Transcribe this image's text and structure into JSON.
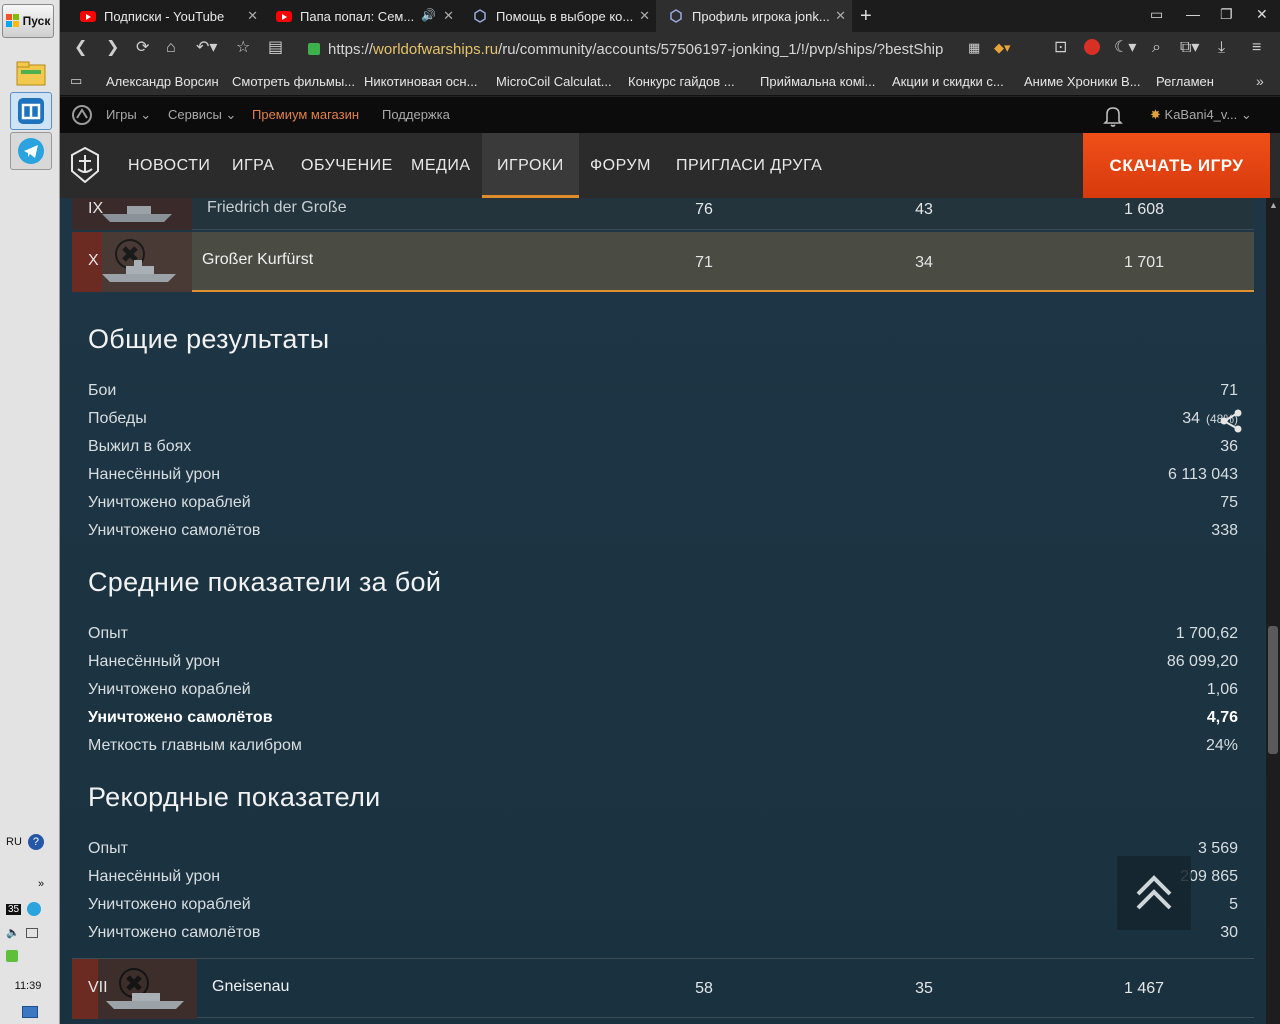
{
  "taskbar": {
    "start_label": "Пуск",
    "tray": {
      "lang": "RU",
      "badge": "35",
      "time": "11:39"
    }
  },
  "browser": {
    "tabs": [
      {
        "title": "Подписки - YouTube",
        "favicon": "youtube-icon"
      },
      {
        "title": "Папа попал: Сем...",
        "favicon": "youtube-icon",
        "audio": true
      },
      {
        "title": "Помощь в выборе ко...",
        "favicon": "wows-icon"
      },
      {
        "title": "Профиль игрока jonk...",
        "favicon": "wows-icon",
        "active": true
      }
    ],
    "url_prefix": "https://",
    "url_domain": "worldofwarships.ru",
    "url_path": "/ru/community/accounts/57506197-jonking_1/!/pvp/ships/?bestShip",
    "bookmarks": [
      "Александр Ворсин",
      "Смотреть фильмы...",
      "Никотиновая осн...",
      "MicroCoil Calculat...",
      "Конкурс гайдов ...",
      "Приймальна комі...",
      "Акции и скидки с...",
      "Аниме Хроники В...",
      "Регламен"
    ]
  },
  "site": {
    "top_menu": {
      "games": "Игры",
      "services": "Сервисы",
      "premium": "Премиум магазин",
      "support": "Поддержка",
      "user": "KaBani4_v..."
    },
    "nav": [
      "НОВОСТИ",
      "ИГРА",
      "ОБУЧЕНИЕ",
      "МЕДИА",
      "ИГРОКИ",
      "ФОРУМ",
      "ПРИГЛАСИ ДРУГА"
    ],
    "active_nav": "ИГРОКИ",
    "download": "СКАЧАТЬ ИГРУ"
  },
  "ships": {
    "prev": {
      "tier": "IX",
      "name": "Friedrich der Große",
      "battles": "76",
      "wins": "43",
      "exp": "1 608"
    },
    "selected": {
      "tier": "X",
      "name": "Großer Kurfürst",
      "battles": "71",
      "wins": "34",
      "exp": "1 701"
    },
    "next": {
      "tier": "VII",
      "name": "Gneisenau",
      "battles": "58",
      "wins": "35",
      "exp": "1 467"
    }
  },
  "overall": {
    "title": "Общие результаты",
    "rows": [
      {
        "label": "Бои",
        "value": "71"
      },
      {
        "label": "Победы",
        "value": "34",
        "extra": "(48%)"
      },
      {
        "label": "Выжил в боях",
        "value": "36"
      },
      {
        "label": "Нанесённый урон",
        "value": "6 113 043"
      },
      {
        "label": "Уничтожено кораблей",
        "value": "75"
      },
      {
        "label": "Уничтожено самолётов",
        "value": "338"
      }
    ]
  },
  "average": {
    "title": "Средние показатели за бой",
    "rows": [
      {
        "label": "Опыт",
        "value": "1 700,62"
      },
      {
        "label": "Нанесённый урон",
        "value": "86 099,20"
      },
      {
        "label": "Уничтожено кораблей",
        "value": "1,06"
      },
      {
        "label": "Уничтожено самолётов",
        "value": "4,76"
      },
      {
        "label": "Меткость главным калибром",
        "value": "24%"
      }
    ]
  },
  "records": {
    "title": "Рекордные показатели",
    "rows": [
      {
        "label": "Опыт",
        "value": "3 569"
      },
      {
        "label": "Нанесённый урон",
        "value": "209 865"
      },
      {
        "label": "Уничтожено кораблей",
        "value": "5"
      },
      {
        "label": "Уничтожено самолётов",
        "value": "30"
      }
    ]
  },
  "colors": {
    "accent": "#e08c2a",
    "download_bg": "#e8461a",
    "premium_link": "#e0804a",
    "content_bg": "#1d3544"
  }
}
